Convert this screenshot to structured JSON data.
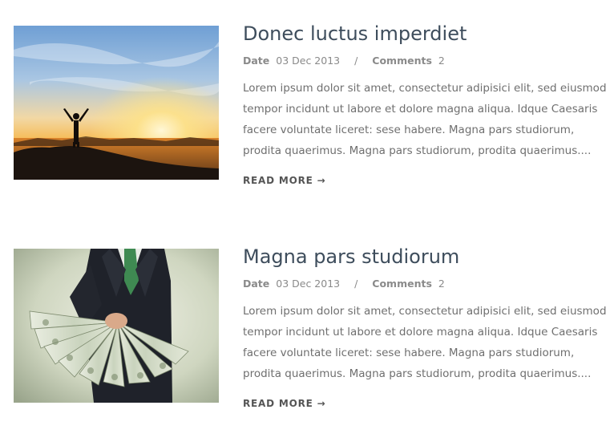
{
  "posts": [
    {
      "title": "Donec luctus imperdiet",
      "date_label": "Date",
      "date": "03 Dec 2013",
      "separator": "/",
      "comments_label": "Comments",
      "comments_count": "2",
      "excerpt_lines": [
        "Lorem ipsum dolor sit amet, consectetur adipisici elit, sed eiusmod",
        "tempor incidunt ut labore et dolore magna aliqua. Idque Caesaris",
        "facere voluntate liceret: sese habere. Magna pars studiorum,",
        "prodita quaerimus. Magna pars studiorum, prodita quaerimus...."
      ],
      "read_more": "READ MORE →",
      "image_icon": "sunset-silhouette-image"
    },
    {
      "title": "Magna pars studiorum",
      "date_label": "Date",
      "date": "03 Dec 2013",
      "separator": "/",
      "comments_label": "Comments",
      "comments_count": "2",
      "excerpt_lines": [
        "Lorem ipsum dolor sit amet, consectetur adipisici elit, sed eiusmod",
        "tempor incidunt ut labore et dolore magna aliqua. Idque Caesaris",
        "facere voluntate liceret: sese habere. Magna pars studiorum,",
        "prodita quaerimus. Magna pars studiorum, prodita quaerimus...."
      ],
      "read_more": "READ MORE →",
      "image_icon": "businessman-money-fan-image"
    }
  ],
  "colors": {
    "title": "#3e4d5c",
    "meta": "#8a8a8a",
    "body_text": "#6f6f6f",
    "read_more": "#555555"
  }
}
